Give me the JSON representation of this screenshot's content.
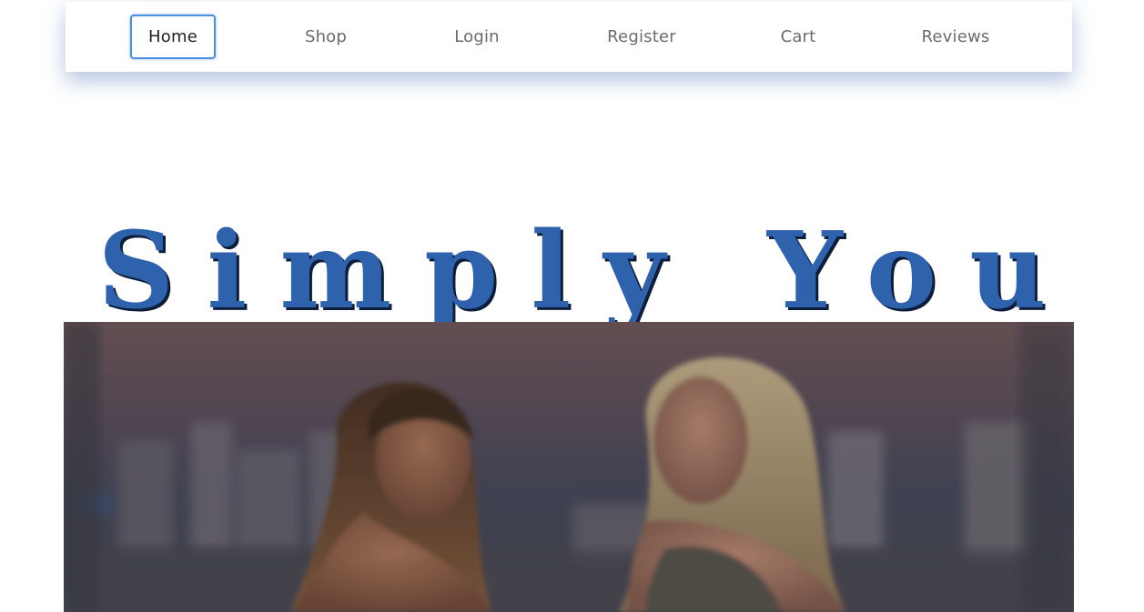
{
  "nav": {
    "items": [
      {
        "label": "Home",
        "active": true
      },
      {
        "label": "Shop"
      },
      {
        "label": "Login"
      },
      {
        "label": "Register"
      },
      {
        "label": "Cart"
      },
      {
        "label": "Reviews"
      }
    ]
  },
  "site_title": "Simply You",
  "colors": {
    "title": "#2f62ad",
    "title_shadow": "#0e1e3a",
    "nav_focus": "#4a8ee0",
    "nav_text": "#6b6b6b"
  },
  "hero": {
    "image_description_icon": "hero-photo"
  }
}
